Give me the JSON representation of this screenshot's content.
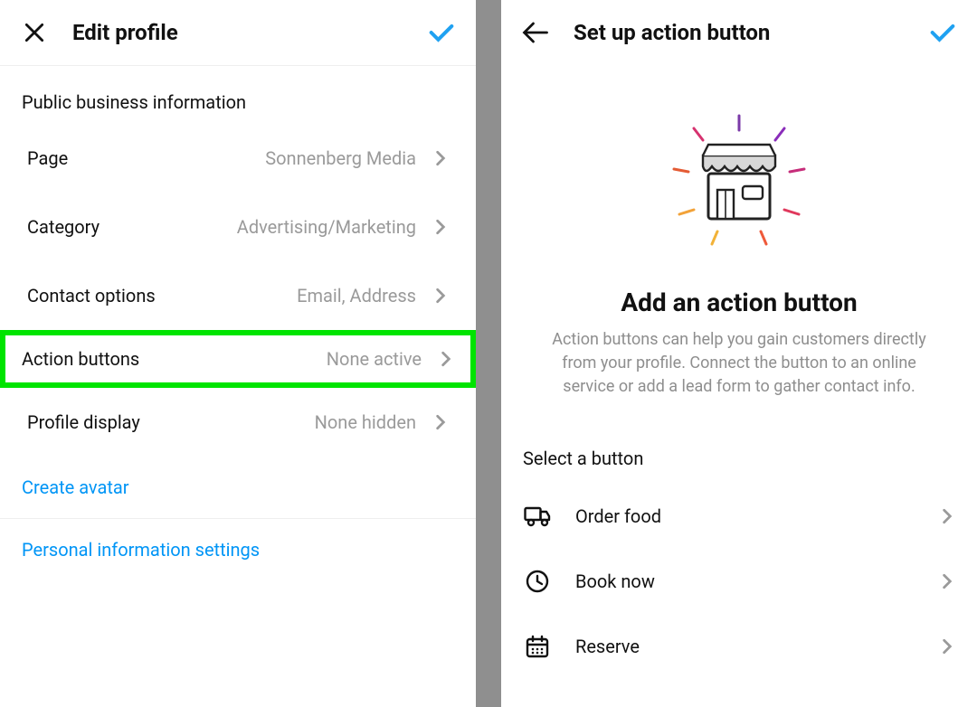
{
  "left": {
    "header": {
      "title": "Edit profile"
    },
    "section_label": "Public business information",
    "rows": {
      "page": {
        "label": "Page",
        "value": "Sonnenberg Media"
      },
      "category": {
        "label": "Category",
        "value": "Advertising/Marketing"
      },
      "contact": {
        "label": "Contact options",
        "value": "Email, Address"
      },
      "action": {
        "label": "Action buttons",
        "value": "None active"
      },
      "display": {
        "label": "Profile display",
        "value": "None hidden"
      }
    },
    "links": {
      "avatar": "Create avatar",
      "personal": "Personal information settings"
    }
  },
  "right": {
    "header": {
      "title": "Set up action button"
    },
    "hero": {
      "title": "Add an action button",
      "desc": "Action buttons can help you gain customers directly from your profile. Connect the button to an online service or add a lead form to gather contact info."
    },
    "select_label": "Select a button",
    "options": {
      "order": "Order food",
      "book": "Book now",
      "reserve": "Reserve"
    }
  }
}
